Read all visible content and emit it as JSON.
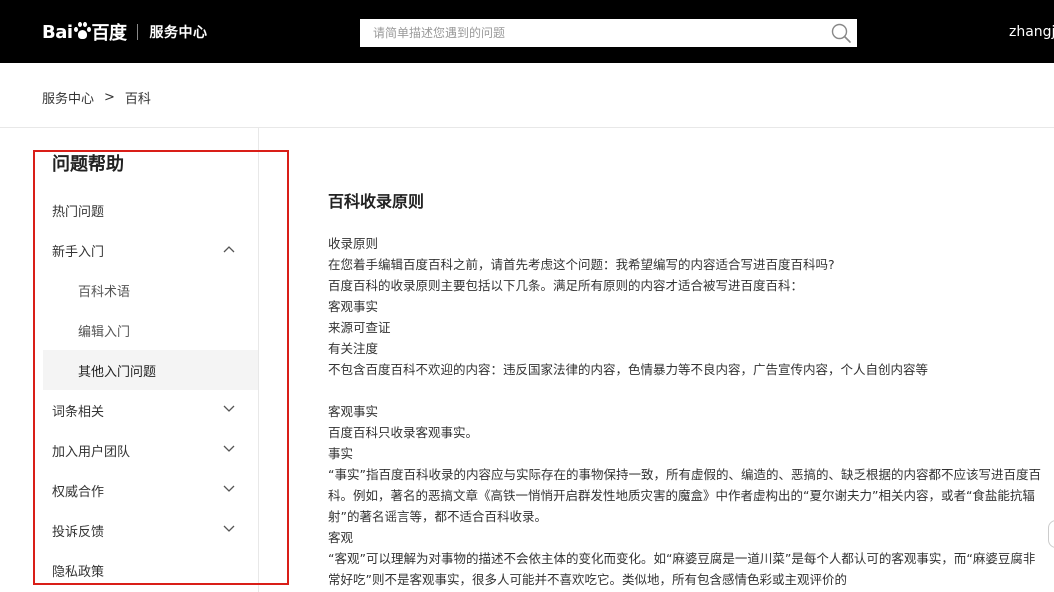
{
  "header": {
    "logo_text_left": "Bai",
    "logo_text_right": "百度",
    "logo_subtitle": "服务中心",
    "search_placeholder": "请简单描述您遇到的问题",
    "username": "zhangj"
  },
  "breadcrumb": {
    "home": "服务中心",
    "separator": ">",
    "current": "百科"
  },
  "sidebar": {
    "title": "问题帮助",
    "items": [
      {
        "label": "热门问题"
      },
      {
        "label": "新手入门"
      },
      {
        "label": "百科术语"
      },
      {
        "label": "编辑入门"
      },
      {
        "label": "其他入门问题"
      },
      {
        "label": "词条相关"
      },
      {
        "label": "加入用户团队"
      },
      {
        "label": "权威合作"
      },
      {
        "label": "投诉反馈"
      },
      {
        "label": "隐私政策"
      }
    ]
  },
  "article": {
    "title": "百科收录原则",
    "block1": [
      "收录原则",
      "在您着手编辑百度百科之前，请首先考虑这个问题：我希望编写的内容适合写进百度百科吗?",
      "百度百科的收录原则主要包括以下几条。满足所有原则的内容才适合被写进百度百科：",
      "客观事实",
      "来源可查证",
      "有关注度",
      "不包含百度百科不欢迎的内容：违反国家法律的内容，色情暴力等不良内容，广告宣传内容，个人自创内容等"
    ],
    "block2": [
      "客观事实",
      "百度百科只收录客观事实。",
      "事实",
      "“事实”指百度百科收录的内容应与实际存在的事物保持一致，所有虚假的、编造的、恶搞的、缺乏根据的内容都不应该写进百度百科。例如，著名的恶搞文章《高铁一悄悄开启群发性地质灾害的魔盒》中作者虚构出的“夏尔谢夫力”相关内容，或者“食盐能抗辐射”的著名谣言等，都不适合百科收录。",
      "客观",
      "“客观”可以理解为对事物的描述不会依主体的变化而变化。如“麻婆豆腐是一道川菜”是每个人都认可的客观事实，而“麻婆豆腐非常好吃”则不是客观事实，很多人可能并不喜欢吃它。类似地，所有包含感情色彩或主观评价的"
    ]
  },
  "colors": {
    "header_bg": "#000000",
    "highlight_border": "#d91e18",
    "active_bg": "#f4f4f4"
  },
  "icons": {
    "search": "search-icon",
    "collapse": "chevron-up-icon",
    "expand": "chevron-down-icon"
  }
}
